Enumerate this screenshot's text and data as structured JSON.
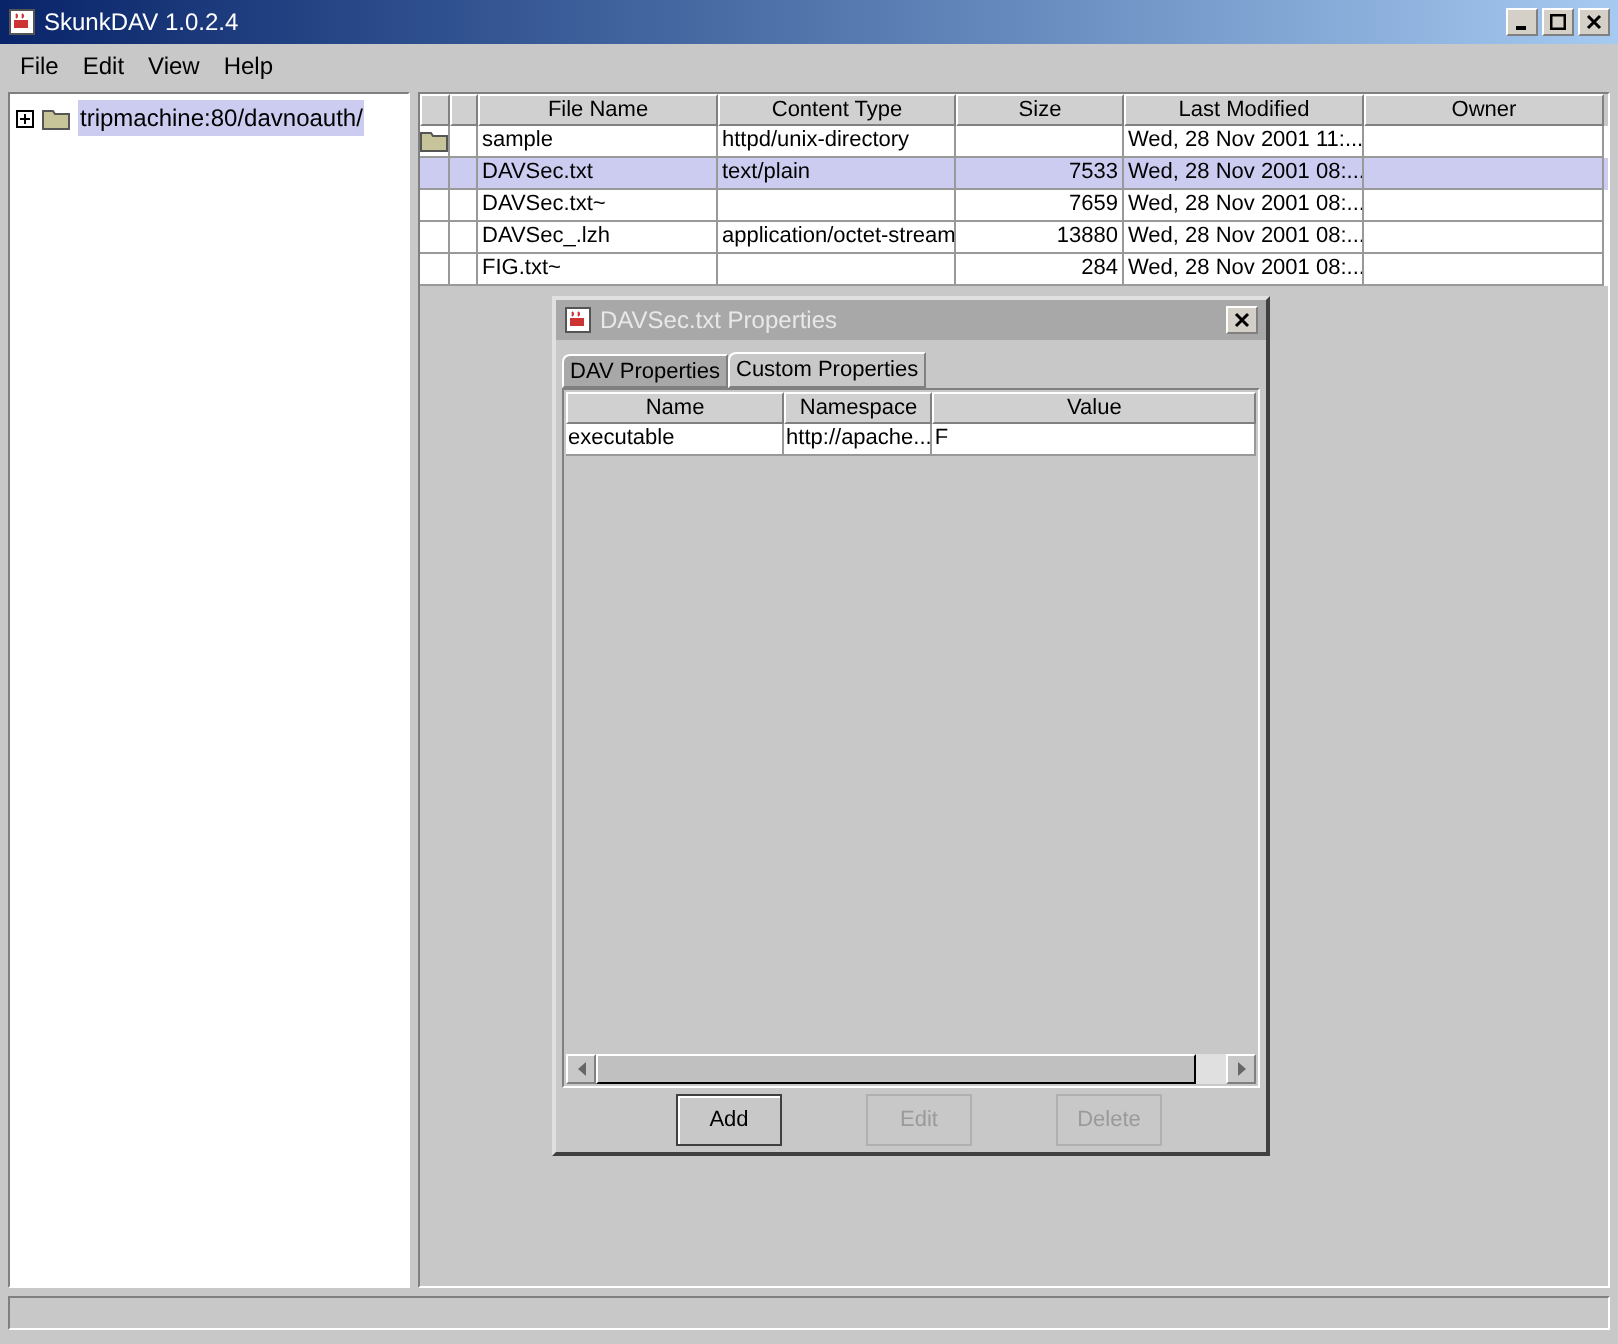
{
  "window": {
    "title": "SkunkDAV 1.0.2.4"
  },
  "menu": [
    "File",
    "Edit",
    "View",
    "Help"
  ],
  "tree": [
    {
      "label": "tripmachine:80/davnoauth/",
      "expanded": false,
      "selected": true
    }
  ],
  "table": {
    "columns": [
      "File Name",
      "Content Type",
      "Size",
      "Last Modified",
      "Owner"
    ],
    "rows": [
      {
        "kind": "folder",
        "selected": false,
        "cells": [
          "sample",
          "httpd/unix-directory",
          "",
          "Wed, 28 Nov 2001 11:...",
          ""
        ]
      },
      {
        "kind": "file",
        "selected": true,
        "cells": [
          "DAVSec.txt",
          "text/plain",
          "7533",
          "Wed, 28 Nov 2001 08:...",
          ""
        ]
      },
      {
        "kind": "file",
        "selected": false,
        "cells": [
          "DAVSec.txt~",
          "",
          "7659",
          "Wed, 28 Nov 2001 08:...",
          ""
        ]
      },
      {
        "kind": "file",
        "selected": false,
        "cells": [
          "DAVSec_.lzh",
          "application/octet-stream",
          "13880",
          "Wed, 28 Nov 2001 08:...",
          ""
        ]
      },
      {
        "kind": "file",
        "selected": false,
        "cells": [
          "FIG.txt~",
          "",
          "284",
          "Wed, 28 Nov 2001 08:...",
          ""
        ]
      }
    ]
  },
  "dialog": {
    "title": "DAVSec.txt Properties",
    "tabs": [
      {
        "label": "DAV Properties",
        "selected": false
      },
      {
        "label": "Custom Properties",
        "selected": true
      }
    ],
    "columns": [
      "Name",
      "Namespace",
      "Value"
    ],
    "rows": [
      [
        "executable",
        "http://apache...",
        "F"
      ]
    ],
    "buttons": [
      {
        "label": "Add",
        "disabled": false
      },
      {
        "label": "Edit",
        "disabled": true
      },
      {
        "label": "Delete",
        "disabled": true
      }
    ]
  }
}
